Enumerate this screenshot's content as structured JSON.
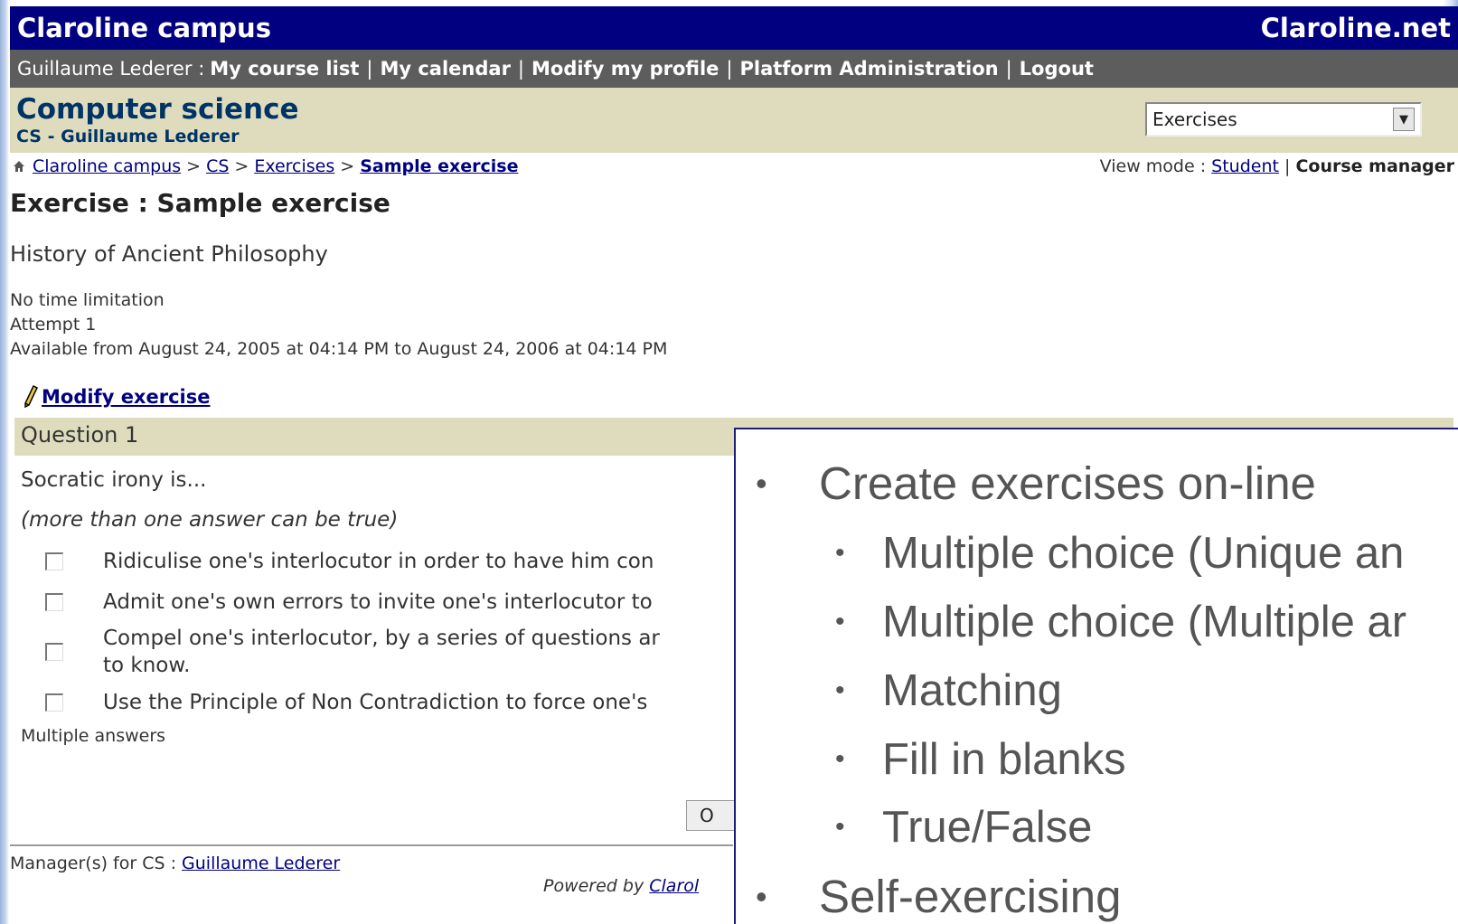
{
  "header": {
    "site_name": "Claroline campus",
    "site_link": "Claroline.net"
  },
  "userbar": {
    "user": "Guillaume Lederer :",
    "links": [
      "My course list",
      "My calendar",
      "Modify my profile",
      "Platform Administration",
      "Logout"
    ]
  },
  "course": {
    "title": "Computer science",
    "subtitle": "CS - Guillaume Lederer",
    "tool_select": "Exercises"
  },
  "breadcrumb": {
    "items": [
      "Claroline campus",
      "CS",
      "Exercises",
      "Sample exercise"
    ],
    "separator": ">"
  },
  "view_mode": {
    "label": "View mode :",
    "student": "Student",
    "sep": "|",
    "manager": "Course manager"
  },
  "exercise": {
    "title": "Exercise : Sample exercise",
    "description": "History of Ancient Philosophy",
    "time": "No time limitation",
    "attempt": "Attempt 1",
    "availability": "Available from August 24, 2005 at 04:14 PM to August 24, 2006 at 04:14 PM",
    "modify_link": "Modify exercise"
  },
  "question": {
    "heading": "Question 1",
    "text": "Socratic irony is...",
    "hint": "(more than one answer can be true)",
    "answers": [
      "Ridiculise one's interlocutor in order to have him con",
      "Admit one's own errors to invite one's interlocutor to",
      "Compel one's interlocutor, by a series of questions ar",
      "to know.",
      "Use the Principle of Non Contradiction to force one's"
    ],
    "type": "Multiple answers",
    "ok_button": "O"
  },
  "footer": {
    "managers_label": "Manager(s) for CS :",
    "manager_name": "Guillaume Lederer",
    "powered_label": "Powered by",
    "powered_link": "Clarol"
  },
  "slide": {
    "bullets": [
      "Create exercises on-line",
      "Multiple choice (Unique an",
      "Multiple choice (Multiple ar",
      "Matching",
      "Fill in blanks",
      "True/False",
      "Self-exercising"
    ],
    "bullet_glyph": "•"
  }
}
